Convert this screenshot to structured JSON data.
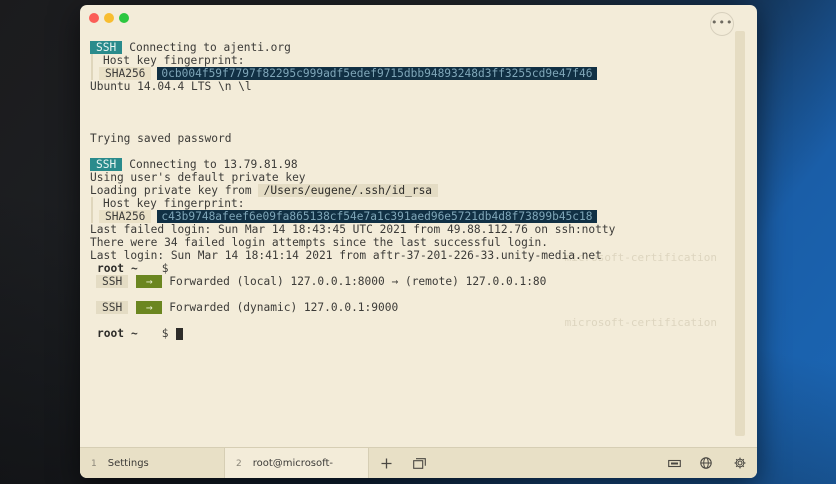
{
  "window": {
    "menu_label": "•••"
  },
  "terminal": {
    "block1": {
      "tag": "SSH",
      "connect": "Connecting to ajenti.org",
      "fp_heading": "Host key fingerprint:",
      "sha_label": "SHA256",
      "hash": "0cb004f59f7797f82295c999adf5edef9715dbb94893248d3ff3255cd9e47f46",
      "banner": "Ubuntu 14.04.4 LTS \\n \\l"
    },
    "trying": "Trying saved password",
    "block2": {
      "tag": "SSH",
      "connect": "Connecting to 13.79.81.98",
      "default_key": "Using user's default private key",
      "loading": "Loading private key from",
      "key_path": "/Users/eugene/.ssh/id_rsa",
      "fp_heading": "Host key fingerprint:",
      "sha_label": "SHA256",
      "hash": "c43b9748afeef6e09fa865138cf54e7a1c391aed96e5721db4d8f73899b45c18",
      "failed": "Last failed login: Sun Mar 14 18:43:45 UTC 2021 from 49.88.112.76 on ssh:notty",
      "attempts": "There were 34 failed login attempts since the last successful login.",
      "last_login": "Last login: Sun Mar 14 18:41:14 2021 from aftr-37-201-226-33.unity-media.net"
    },
    "prompt": {
      "user": "root",
      "tilde": "~",
      "dollar": "$"
    },
    "forward1": {
      "chip": "SSH",
      "arrow": "→",
      "text": "Forwarded (local) 127.0.0.1:8000 → (remote) 127.0.0.1:80"
    },
    "forward2": {
      "chip": "SSH",
      "arrow": "→",
      "text": "Forwarded (dynamic) 127.0.0.1:9000"
    },
    "ghost_text": "microsoft-certification"
  },
  "tabs": [
    {
      "num": "1",
      "label": "Settings"
    },
    {
      "num": "2",
      "label": "root@microsoft-certifi..."
    }
  ],
  "icons": {
    "new_tab": "plus-icon",
    "duplicate": "windows-icon",
    "serial": "plug-icon",
    "globe": "globe-icon",
    "settings": "gear-icon"
  }
}
